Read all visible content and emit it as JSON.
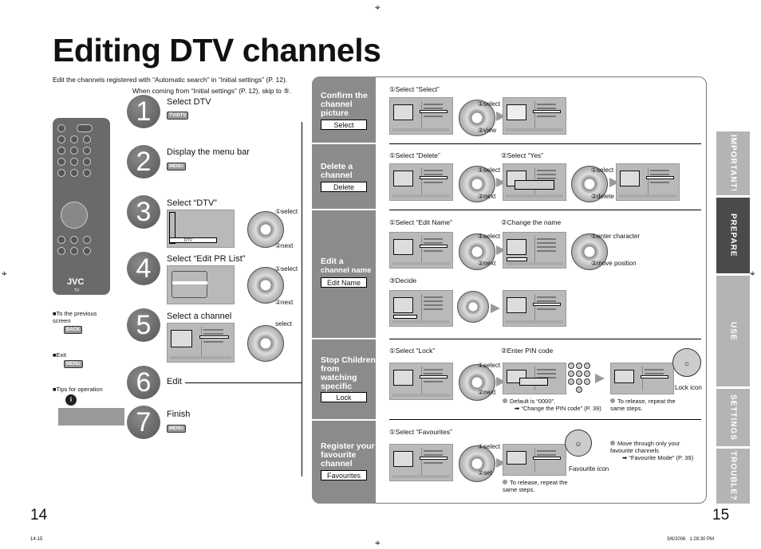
{
  "title": "Editing DTV channels",
  "intro": "Edit the channels registered with “Automatic search” in “Initial settings” (P. 12).",
  "intro2": "When coming from “Initial settings” (P. 12), skip to ⑤.",
  "steps": [
    {
      "num": "1",
      "label": "Select DTV",
      "button": "TV/DTV"
    },
    {
      "num": "2",
      "label": "Display the menu bar",
      "button": "MENU"
    },
    {
      "num": "3",
      "label": "Select “DTV”",
      "screen_item": "DTV",
      "ann1": "①select",
      "ann2": "②next"
    },
    {
      "num": "4",
      "label": "Select “Edit PR List”",
      "ann1": "①select",
      "ann2": "②next"
    },
    {
      "num": "5",
      "label": "Select a channel",
      "ann1": "select"
    },
    {
      "num": "6",
      "label": "Edit"
    },
    {
      "num": "7",
      "label": "Finish",
      "button": "MENU"
    }
  ],
  "notes": [
    {
      "label": "To the previous screen",
      "button": "BACK"
    },
    {
      "label": "Exit",
      "button": "MENU"
    },
    {
      "label": "Tips for operation",
      "button": "i"
    }
  ],
  "remote_brand": "JVC",
  "remote_sub": "TV",
  "sections": [
    {
      "title": "Confirm the channel picture",
      "box": "Select",
      "h1": "①Select “Select”",
      "ann": [
        "①select",
        "②view"
      ]
    },
    {
      "title": "Delete a channel",
      "box": "Delete",
      "h1": "①Select “Delete”",
      "h2": "②Select “Yes”",
      "ann": [
        "①select",
        "②next"
      ],
      "ann2": [
        "①select",
        "②delete"
      ]
    },
    {
      "title": "Edit a",
      "title2": "channel name",
      "box": "Edit Name",
      "h1": "①Select “Edit Name”",
      "h2": "②Change the name",
      "h3": "③Decide",
      "ann": [
        "①select",
        "②next"
      ],
      "ann2": [
        "①enter character",
        "②move position"
      ]
    },
    {
      "title": "Stop Children from watching specific channels",
      "box": "Lock",
      "h1": "①Select “Lock”",
      "h2": "②Enter PIN code",
      "ann": [
        "①select",
        "②next"
      ],
      "note1": "Default is “0000”.",
      "note1b": "➡ “Change the PIN code” (P. 39)",
      "note2": "To release, repeat the same steps.",
      "icon_label": "Lock icon"
    },
    {
      "title": "Register your favourite channel",
      "box": "Favourites",
      "h1": "①Select “Favourites”",
      "ann": [
        "①select",
        "②set"
      ],
      "note1": "To release, repeat the same steps.",
      "note2": "Move through only your favourite channels",
      "note2b": "➡ “Favourite Mode” (P. 39)",
      "icon_label": "Favourite icon"
    }
  ],
  "tabs": [
    "IMPORTANT!",
    "PREPARE",
    "USE",
    "SETTINGS",
    "TROUBLE?"
  ],
  "active_tab": "PREPARE",
  "page_left": "14",
  "page_right": "15",
  "footer_left": "14-15",
  "footer_right": "3/6/2006   1:28:30 PM"
}
